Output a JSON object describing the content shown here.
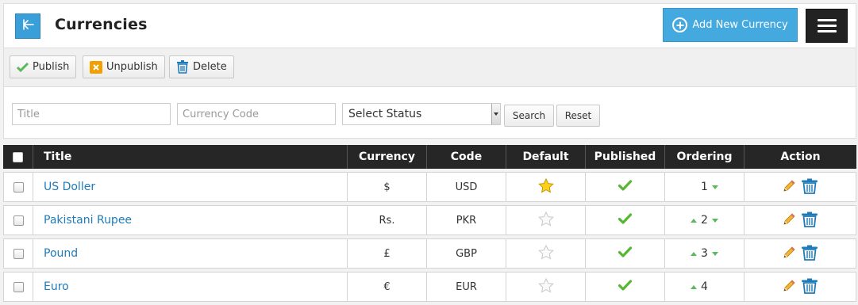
{
  "header": {
    "title": "Currencies",
    "add_button_label": "Add New Currency",
    "brand_color": "#44a9df"
  },
  "toolbar": {
    "publish_label": "Publish",
    "unpublish_label": "Unpublish",
    "delete_label": "Delete"
  },
  "filters": {
    "title_placeholder": "Title",
    "code_placeholder": "Currency Code",
    "status_selected": "Select Status",
    "search_label": "Search",
    "reset_label": "Reset"
  },
  "table": {
    "columns": [
      "Title",
      "Currency",
      "Code",
      "Default",
      "Published",
      "Ordering",
      "Action"
    ],
    "rows": [
      {
        "title": "US Doller",
        "currency": "$",
        "code": "USD",
        "default": true,
        "published": true,
        "ordering": "1",
        "can_up": false,
        "can_down": true
      },
      {
        "title": "Pakistani Rupee",
        "currency": "Rs.",
        "code": "PKR",
        "default": false,
        "published": true,
        "ordering": "2",
        "can_up": true,
        "can_down": true
      },
      {
        "title": "Pound",
        "currency": "£",
        "code": "GBP",
        "default": false,
        "published": true,
        "ordering": "3",
        "can_up": true,
        "can_down": true
      },
      {
        "title": "Euro",
        "currency": "€",
        "code": "EUR",
        "default": false,
        "published": true,
        "ordering": "4",
        "can_up": true,
        "can_down": false
      }
    ]
  },
  "icons": {
    "back": "arrow-left-icon",
    "add": "plus-circle-icon",
    "menu": "hamburger-menu-icon",
    "publish": "checkmark-icon",
    "unpublish": "x-icon",
    "delete": "trash-icon",
    "default_on": "star-filled-icon",
    "default_off": "star-empty-icon",
    "published": "checkmark-icon",
    "edit": "pencil-icon",
    "remove": "trash-icon"
  }
}
